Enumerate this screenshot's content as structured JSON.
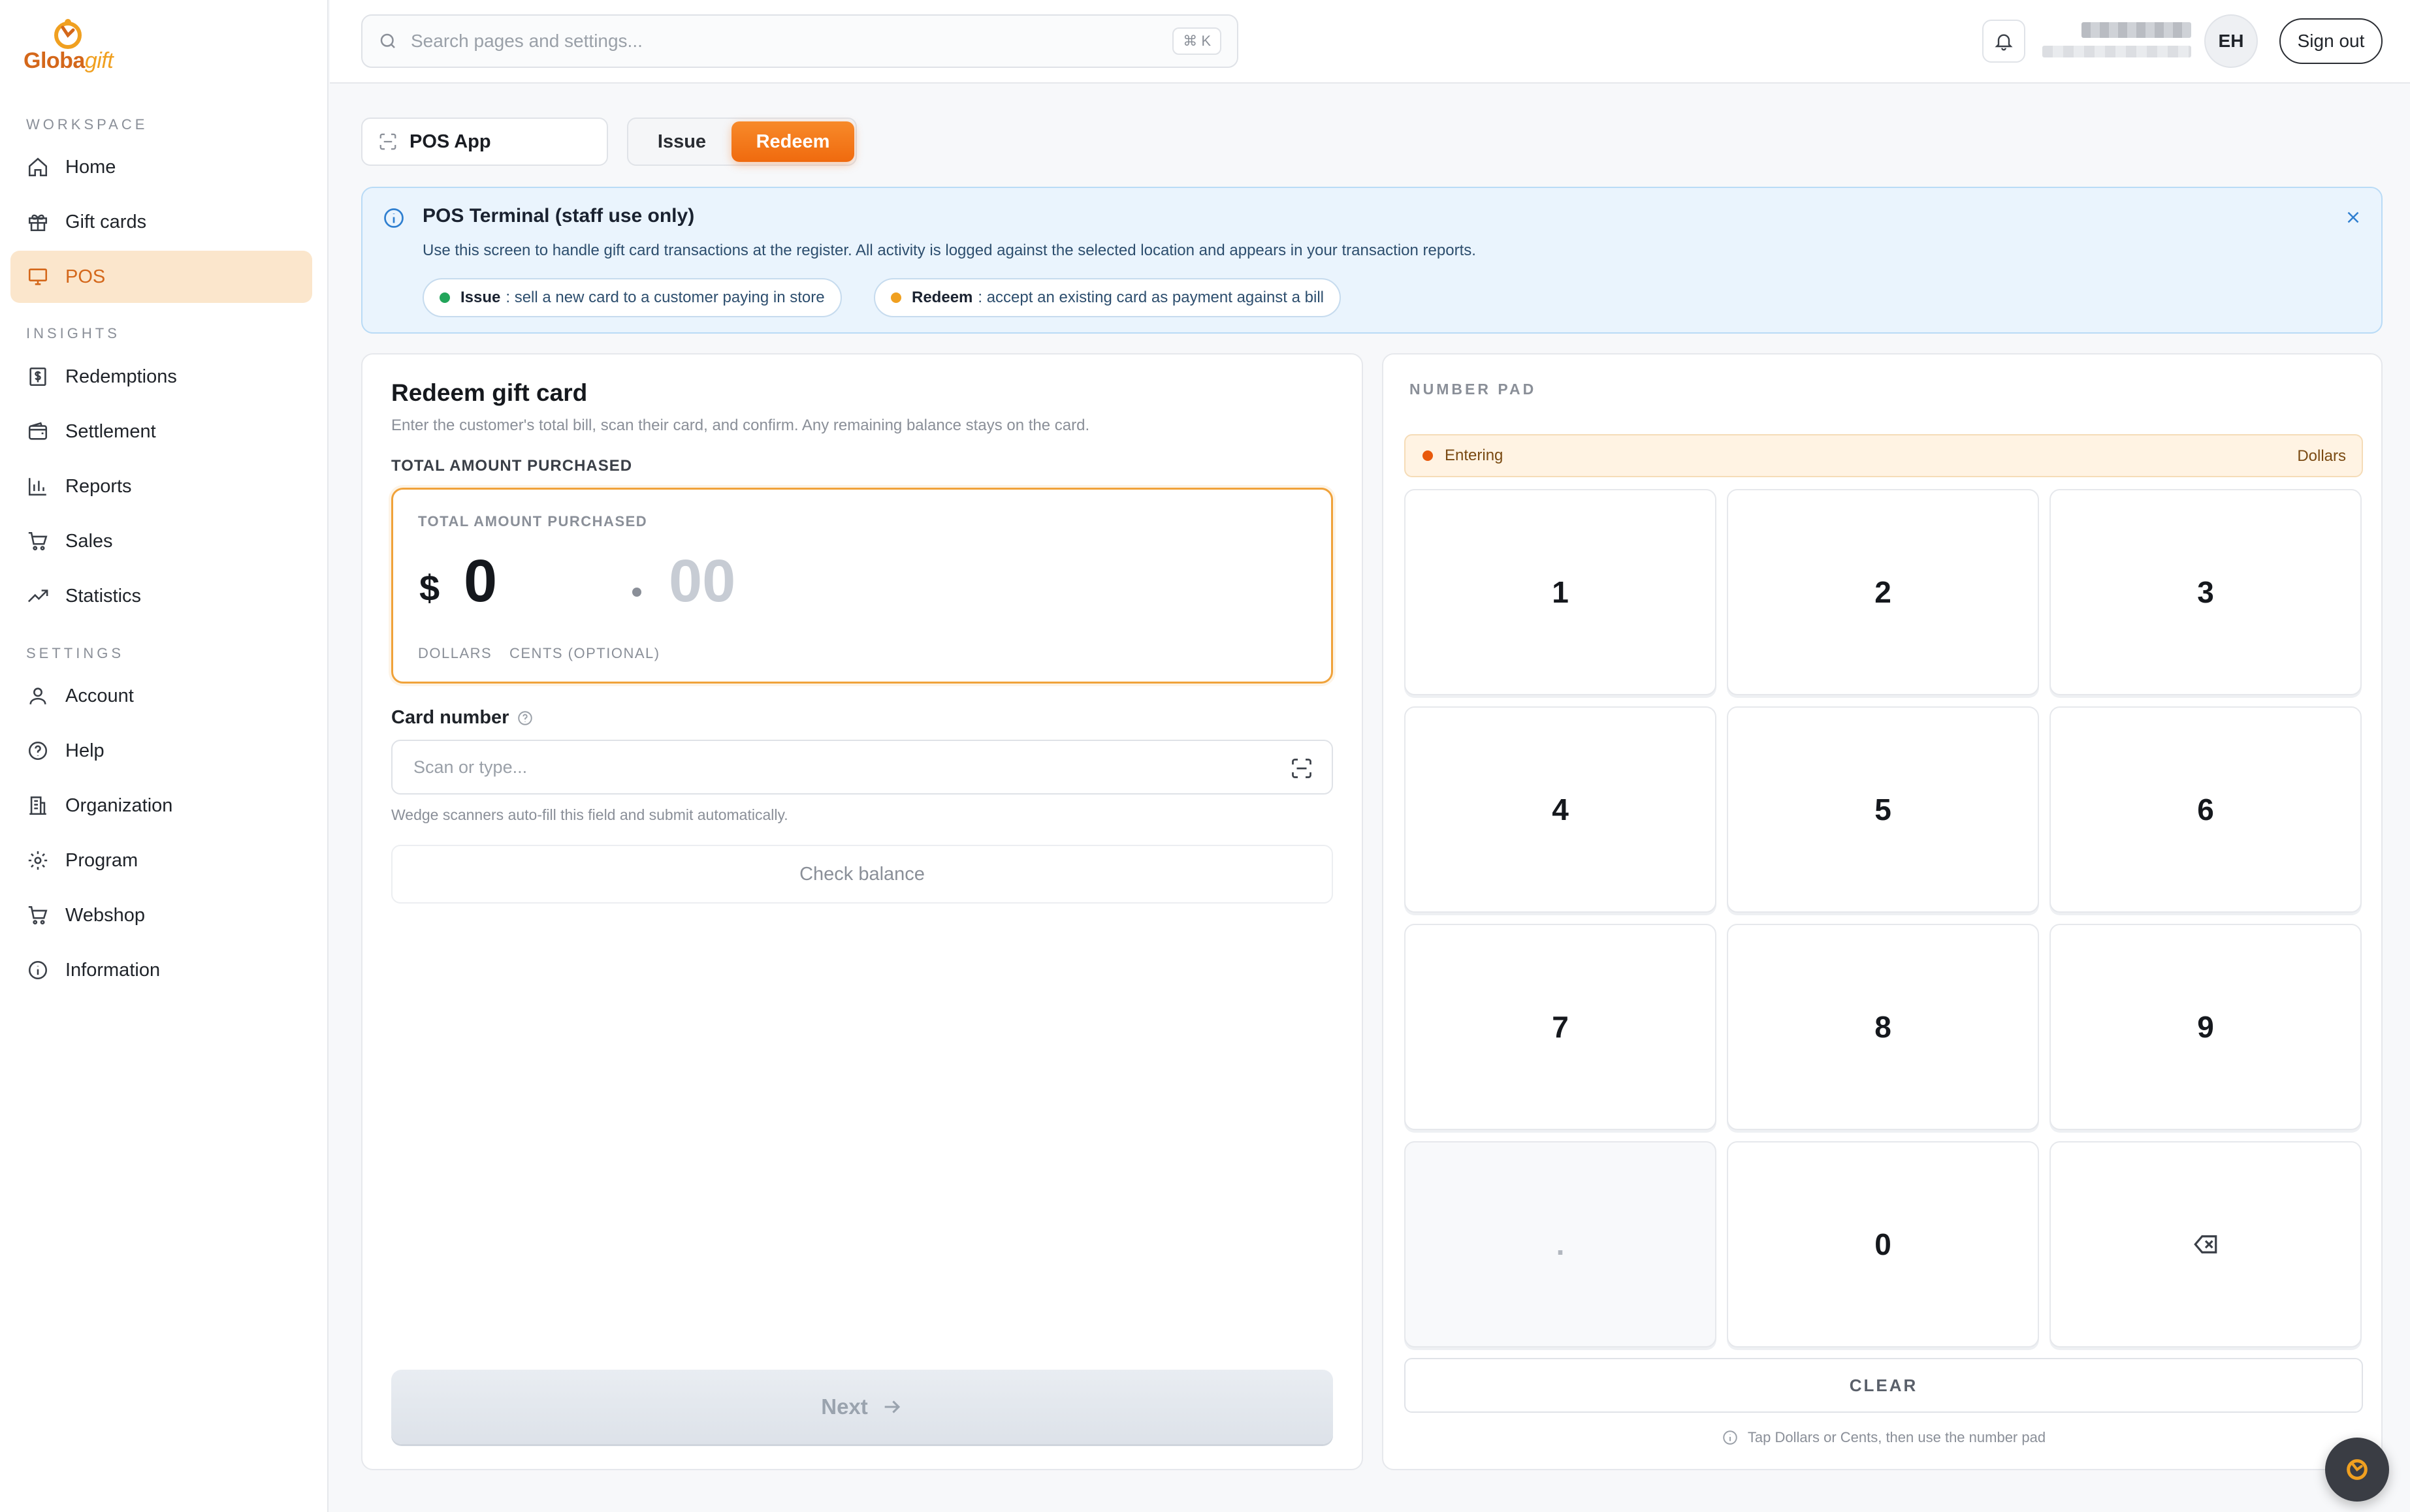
{
  "brand": {
    "name_part1": "Globa",
    "name_part2": "gift",
    "accent": "#f06a0e",
    "brand_color": "#d4671a"
  },
  "sidebar": {
    "sections": [
      {
        "label": "WORKSPACE"
      },
      {
        "label": "INSIGHTS"
      },
      {
        "label": "SETTINGS"
      }
    ],
    "items": [
      {
        "label": "Home",
        "icon": "home-icon"
      },
      {
        "label": "Gift cards",
        "icon": "gift-icon"
      },
      {
        "label": "POS",
        "icon": "monitor-icon",
        "active": true
      },
      {
        "label": "Redemptions",
        "icon": "receipt-dollar-icon"
      },
      {
        "label": "Settlement",
        "icon": "wallet-icon"
      },
      {
        "label": "Reports",
        "icon": "bar-chart-icon"
      },
      {
        "label": "Sales",
        "icon": "cart-icon"
      },
      {
        "label": "Statistics",
        "icon": "trend-up-icon"
      },
      {
        "label": "Account",
        "icon": "user-icon"
      },
      {
        "label": "Help",
        "icon": "help-circle-icon"
      },
      {
        "label": "Organization",
        "icon": "building-icon"
      },
      {
        "label": "Program",
        "icon": "gear-icon"
      },
      {
        "label": "Webshop",
        "icon": "cart-icon"
      },
      {
        "label": "Information",
        "icon": "info-icon"
      }
    ]
  },
  "topbar": {
    "search_placeholder": "Search pages and settings...",
    "shortcut": "⌘ K",
    "avatar_initials": "EH",
    "signout_label": "Sign out"
  },
  "header": {
    "app_button": "POS App",
    "modes": [
      "Issue",
      "Redeem"
    ],
    "active_mode": "Redeem"
  },
  "banner": {
    "title": "POS Terminal (staff use only)",
    "description": "Use this screen to handle gift card transactions at the register. All activity is logged against the selected location and appears in your transaction reports.",
    "chips": [
      {
        "bold": "Issue",
        "text": ": sell a new card to a customer paying in store",
        "color": "#22a55a"
      },
      {
        "bold": "Redeem",
        "text": ": accept an existing card as payment against a bill",
        "color": "#f0a020"
      }
    ]
  },
  "redeem": {
    "title": "Redeem gift card",
    "subtitle": "Enter the customer's total bill, scan their card, and confirm. Any remaining balance stays on the card.",
    "amount_section_label": "TOTAL AMOUNT PURCHASED",
    "amount_inner_label": "TOTAL AMOUNT PURCHASED",
    "currency": "$",
    "dollars": "0",
    "cents_placeholder": "00",
    "dollars_label": "DOLLARS",
    "cents_label": "CENTS (OPTIONAL)",
    "card_number_label": "Card number",
    "card_placeholder": "Scan or type...",
    "card_help": "Wedge scanners auto-fill this field and submit automatically.",
    "check_balance": "Check balance",
    "next": "Next"
  },
  "numpad": {
    "title": "NUMBER PAD",
    "status": "Entering",
    "field": "Dollars",
    "keys": [
      "1",
      "2",
      "3",
      "4",
      "5",
      "6",
      "7",
      "8",
      "9",
      ".",
      "0",
      "⌫"
    ],
    "clear": "CLEAR",
    "tip": "Tap Dollars or Cents, then use the number pad"
  }
}
